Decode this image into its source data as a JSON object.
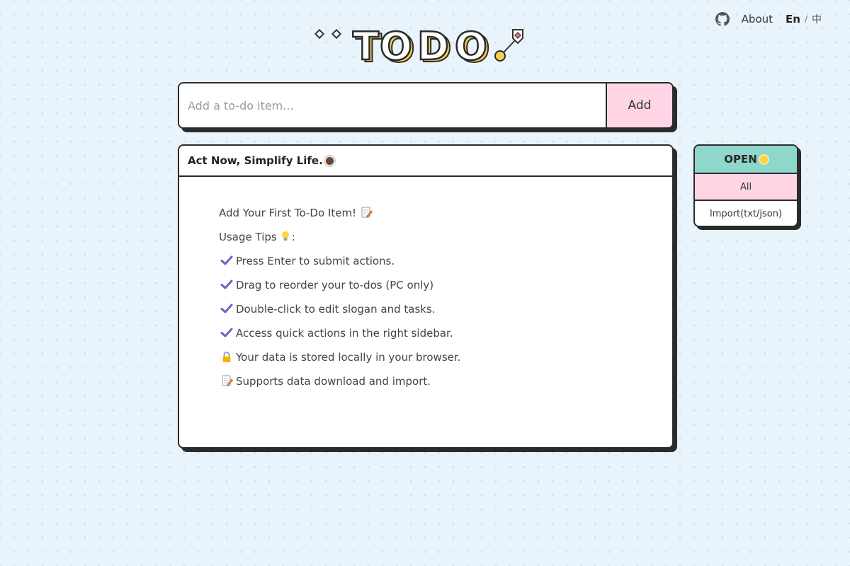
{
  "nav": {
    "about_label": "About",
    "lang_en": "En",
    "lang_sep": "/",
    "lang_zh": "中"
  },
  "logo": {
    "text": "TODO."
  },
  "input": {
    "placeholder": "Add a to-do item...",
    "value": "",
    "add_label": "Add"
  },
  "card": {
    "slogan": "Act Now, Simplify Life.",
    "empty": {
      "first_item": "Add Your First To-Do Item!",
      "usage_tips": "Usage Tips",
      "usage_tips_suffix": ":",
      "tips": [
        {
          "icon": "check-icon",
          "text": "Press Enter to submit actions."
        },
        {
          "icon": "check-icon",
          "text": "Drag to reorder your to-dos (PC only)"
        },
        {
          "icon": "check-icon",
          "text": "Double-click to edit slogan and tasks."
        },
        {
          "icon": "check-icon",
          "text": "Access quick actions in the right sidebar."
        },
        {
          "icon": "lock-icon",
          "text": "Your data is stored locally in your browser."
        },
        {
          "icon": "memo-icon",
          "text": "Supports data download and import."
        }
      ]
    }
  },
  "sidebar": {
    "header": "OPEN",
    "items": [
      {
        "label": "All",
        "active": true
      },
      {
        "label": "Import(txt/json)",
        "active": false
      }
    ]
  },
  "colors": {
    "background": "#e9f3fb",
    "border": "#2b2b2b",
    "pink": "#ffd5e6",
    "teal": "#8fd6cc",
    "yellow": "#ffd966",
    "check": "#7d5cc4"
  }
}
